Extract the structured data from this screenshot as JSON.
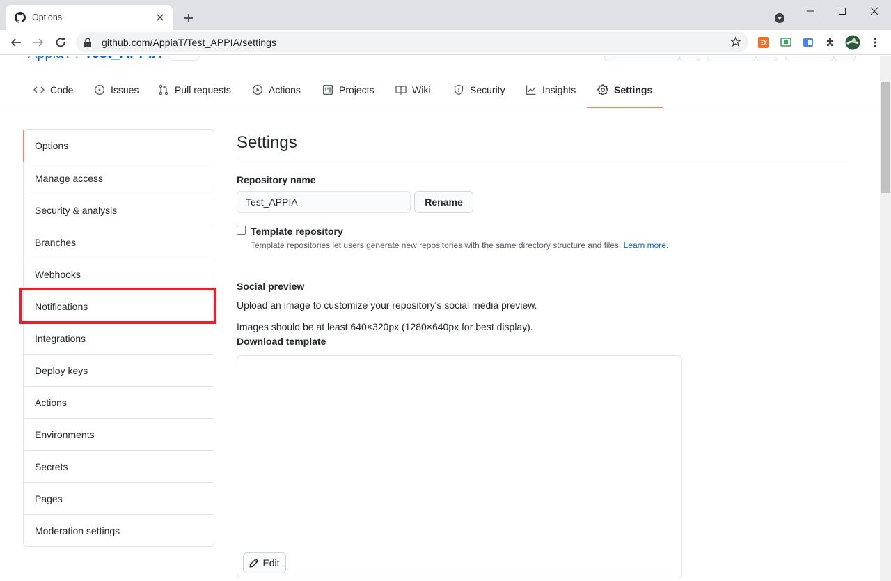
{
  "browser": {
    "tab_title": "Options",
    "url": "github.com/AppiaT/Test_APPIA/settings"
  },
  "repo": {
    "owner": "AppiaT",
    "name": "Test_APPIA"
  },
  "nav": {
    "items": [
      {
        "label": "Code",
        "icon": "code-icon"
      },
      {
        "label": "Issues",
        "icon": "issue-opened-icon"
      },
      {
        "label": "Pull requests",
        "icon": "git-pull-request-icon"
      },
      {
        "label": "Actions",
        "icon": "play-icon"
      },
      {
        "label": "Projects",
        "icon": "project-icon"
      },
      {
        "label": "Wiki",
        "icon": "book-icon"
      },
      {
        "label": "Security",
        "icon": "shield-icon"
      },
      {
        "label": "Insights",
        "icon": "graph-icon"
      },
      {
        "label": "Settings",
        "icon": "gear-icon"
      }
    ],
    "selected": "Settings"
  },
  "menu": {
    "items": [
      "Options",
      "Manage access",
      "Security & analysis",
      "Branches",
      "Webhooks",
      "Notifications",
      "Integrations",
      "Deploy keys",
      "Actions",
      "Environments",
      "Secrets",
      "Pages",
      "Moderation settings"
    ],
    "selected": "Options",
    "highlighted": "Notifications"
  },
  "settings": {
    "title": "Settings",
    "repo_name_label": "Repository name",
    "repo_name_value": "Test_APPIA",
    "rename_label": "Rename",
    "template_label": "Template repository",
    "template_note": "Template repositories let users generate new repositories with the same directory structure and files.",
    "learn_more": "Learn more.",
    "social_title": "Social preview",
    "social_desc": "Upload an image to customize your repository's social media preview.",
    "social_size": "Images should be at least 640×320px (1280×640px for best display).",
    "download_template": "Download template",
    "edit_label": "Edit"
  },
  "colors": {
    "accent_underline": "#f9826c",
    "link": "#0366d6",
    "highlight_box": "#e8202a"
  }
}
